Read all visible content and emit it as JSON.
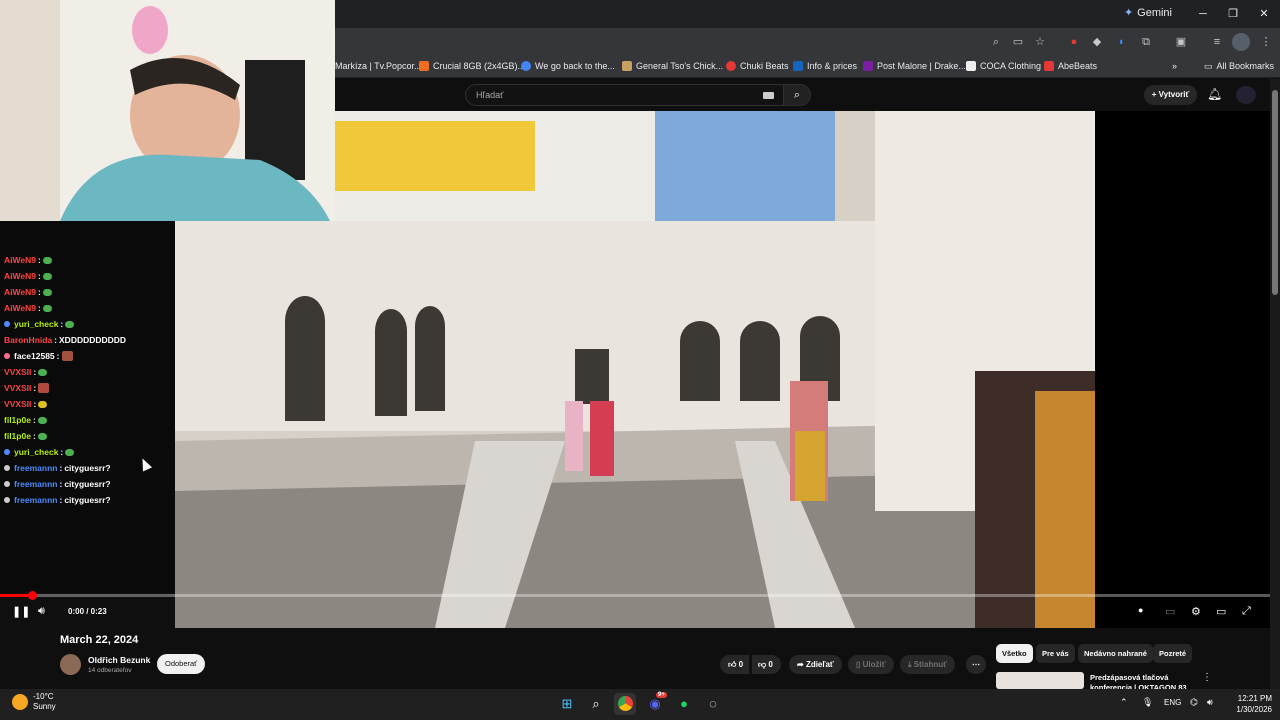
{
  "browser": {
    "gemini_label": "Gemini",
    "bookmarks": [
      {
        "label": "Markíza | Tv.Popcor...",
        "color": "#e94235"
      },
      {
        "label": "Crucial 8GB (2x4GB)...",
        "color": "#f36c21"
      },
      {
        "label": "We go back to the...",
        "color": "#4285f4"
      },
      {
        "label": "General Tso's Chick...",
        "color": "#c8a062"
      },
      {
        "label": "Chuki Beats",
        "color": "#e53935"
      },
      {
        "label": "Info & prices",
        "color": "#1565c0"
      },
      {
        "label": "Post Malone | Drake...",
        "color": "#7b1fa2"
      },
      {
        "label": "COCA Clothing",
        "color": "#222222"
      },
      {
        "label": "AbeBeats",
        "color": "#e53935"
      }
    ],
    "all_bookmarks": "All Bookmarks"
  },
  "youtube": {
    "search_placeholder": "Hľadať",
    "create_label": "Vytvoriť",
    "video": {
      "time": "0:00 / 0:23",
      "progress_fraction": 0.025,
      "date": "March 22, 2024"
    },
    "channel": {
      "name": "Oldřich Bezunk",
      "subs": "14 odberateľov",
      "subscribe": "Odoberať"
    },
    "actions": {
      "likes": "0",
      "dislikes": "0",
      "share": "Zdieľať",
      "save": "Uložiť",
      "download": "Stiahnuť"
    },
    "chips": [
      "Všetko",
      "Pre vás",
      "Nedávno nahrané",
      "Pozreté"
    ],
    "suggestion_title": "Predzápasová tlačová konferencia | OKTAGON 83"
  },
  "chat": [
    {
      "user": "AiWeN9",
      "color": "#ff4545",
      "text": "",
      "emote": true,
      "badge": false
    },
    {
      "user": "AiWeN9",
      "color": "#ff4545",
      "text": "",
      "emote": true,
      "badge": false
    },
    {
      "user": "AiWeN9",
      "color": "#ff4545",
      "text": "",
      "emote": true,
      "badge": false
    },
    {
      "user": "AiWeN9",
      "color": "#ff4545",
      "text": "",
      "emote": true,
      "badge": false
    },
    {
      "user": "yuri_check",
      "color": "#b7f000",
      "text": "",
      "emote": true,
      "badge": true
    },
    {
      "user": "BaronHnida",
      "color": "#ff4545",
      "text": "XDDDDDDDDDD",
      "emote": false,
      "badge": false
    },
    {
      "user": "face12585",
      "color": "#ffffff",
      "text": "",
      "emote": true,
      "badge": true
    },
    {
      "user": "VVXSII",
      "color": "#ff4545",
      "text": "",
      "emote": true,
      "badge": false
    },
    {
      "user": "VVXSII",
      "color": "#ff4545",
      "text": "",
      "emote": true,
      "badge": false
    },
    {
      "user": "VVXSII",
      "color": "#ff4545",
      "text": "",
      "emote": true,
      "badge": false
    },
    {
      "user": "fil1p0e",
      "color": "#b7f000",
      "text": "",
      "emote": true,
      "badge": false
    },
    {
      "user": "fil1p0e",
      "color": "#b7f000",
      "text": "",
      "emote": true,
      "badge": false
    },
    {
      "user": "yuri_check",
      "color": "#b7f000",
      "text": "",
      "emote": true,
      "badge": true
    },
    {
      "user": "freemannn",
      "color": "#4d8cff",
      "text": "cityguesrr?",
      "emote": false,
      "badge": true
    },
    {
      "user": "freemannn",
      "color": "#4d8cff",
      "text": "cityguesrr?",
      "emote": false,
      "badge": true
    },
    {
      "user": "freemannn",
      "color": "#4d8cff",
      "text": "cityguesrr?",
      "emote": false,
      "badge": true
    }
  ],
  "taskbar": {
    "temp": "-10°C",
    "weather": "Sunny",
    "lang": "ENG",
    "time": "12:21 PM",
    "date": "1/30/2026",
    "discord_badge": "9+"
  }
}
